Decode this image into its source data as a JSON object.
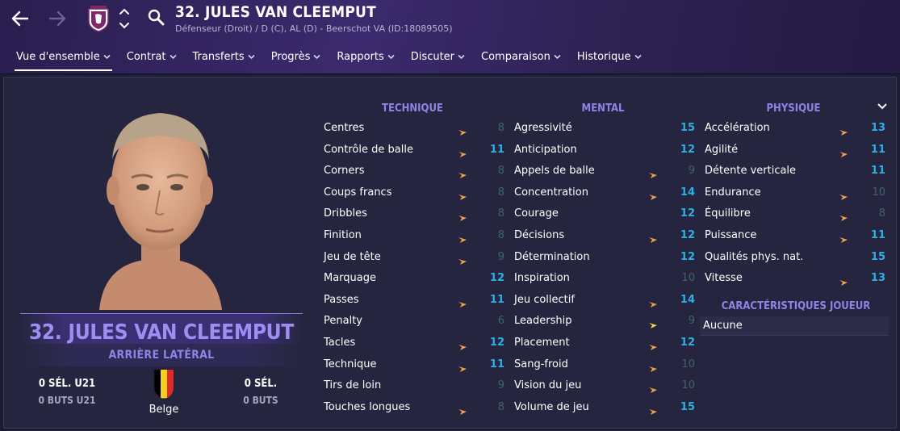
{
  "header": {
    "player_title": "32. JULES VAN CLEEMPUT",
    "player_subtitle": "Défenseur (Droit) / D (C), AL (D) - Beerschot VA (ID:18089505)",
    "icons": [
      "back-arrow-icon",
      "forward-arrow-icon",
      "club-badge-icon",
      "up-down-chevron-icon",
      "search-icon"
    ]
  },
  "tabs": [
    {
      "label": "Vue d'ensemble",
      "active": true
    },
    {
      "label": "Contrat",
      "active": false
    },
    {
      "label": "Transferts",
      "active": false
    },
    {
      "label": "Progrès",
      "active": false
    },
    {
      "label": "Rapports",
      "active": false
    },
    {
      "label": "Discuter",
      "active": false
    },
    {
      "label": "Comparaison",
      "active": false
    },
    {
      "label": "Historique",
      "active": false
    }
  ],
  "profile": {
    "name_banner": "32. JULES VAN CLEEMPUT",
    "role": "ARRIÈRE LATÉRAL",
    "u21_caps": "0 SÉL. U21",
    "u21_goals": "0 BUTS U21",
    "caps": "0 SÉL.",
    "goals": "0 BUTS",
    "nationality": "Belge"
  },
  "technique": {
    "title": "TECHNIQUE",
    "rows": [
      {
        "name": "Centres",
        "value": "8",
        "arrow": "orange"
      },
      {
        "name": "Contrôle de balle",
        "value": "11",
        "arrow": "orange"
      },
      {
        "name": "Corners",
        "value": "8",
        "arrow": "orange"
      },
      {
        "name": "Coups francs",
        "value": "8",
        "arrow": "orange"
      },
      {
        "name": "Dribbles",
        "value": "8",
        "arrow": "orange"
      },
      {
        "name": "Finition",
        "value": "8",
        "arrow": "orange"
      },
      {
        "name": "Jeu de tête",
        "value": "9",
        "arrow": "orange"
      },
      {
        "name": "Marquage",
        "value": "12",
        "arrow": "none"
      },
      {
        "name": "Passes",
        "value": "11",
        "arrow": "orange"
      },
      {
        "name": "Penalty",
        "value": "6",
        "arrow": "none"
      },
      {
        "name": "Tacles",
        "value": "12",
        "arrow": "orange"
      },
      {
        "name": "Technique",
        "value": "11",
        "arrow": "orange"
      },
      {
        "name": "Tirs de loin",
        "value": "9",
        "arrow": "none"
      },
      {
        "name": "Touches longues",
        "value": "8",
        "arrow": "orange"
      }
    ]
  },
  "mental": {
    "title": "MENTAL",
    "rows": [
      {
        "name": "Agressivité",
        "value": "15",
        "arrow": "none"
      },
      {
        "name": "Anticipation",
        "value": "12",
        "arrow": "none"
      },
      {
        "name": "Appels de balle",
        "value": "9",
        "arrow": "orange"
      },
      {
        "name": "Concentration",
        "value": "14",
        "arrow": "orange"
      },
      {
        "name": "Courage",
        "value": "12",
        "arrow": "none"
      },
      {
        "name": "Décisions",
        "value": "12",
        "arrow": "orange"
      },
      {
        "name": "Détermination",
        "value": "12",
        "arrow": "none"
      },
      {
        "name": "Inspiration",
        "value": "10",
        "arrow": "none"
      },
      {
        "name": "Jeu collectif",
        "value": "14",
        "arrow": "orange"
      },
      {
        "name": "Leadership",
        "value": "9",
        "arrow": "yellow"
      },
      {
        "name": "Placement",
        "value": "12",
        "arrow": "orange"
      },
      {
        "name": "Sang-froid",
        "value": "10",
        "arrow": "orange"
      },
      {
        "name": "Vision du jeu",
        "value": "10",
        "arrow": "orange"
      },
      {
        "name": "Volume de jeu",
        "value": "15",
        "arrow": "orange"
      }
    ]
  },
  "physique": {
    "title": "PHYSIQUE",
    "rows": [
      {
        "name": "Accélération",
        "value": "13",
        "arrow": "orange"
      },
      {
        "name": "Agilité",
        "value": "11",
        "arrow": "orange"
      },
      {
        "name": "Détente verticale",
        "value": "11",
        "arrow": "none"
      },
      {
        "name": "Endurance",
        "value": "10",
        "arrow": "orange"
      },
      {
        "name": "Équilibre",
        "value": "8",
        "arrow": "orange"
      },
      {
        "name": "Puissance",
        "value": "11",
        "arrow": "orange"
      },
      {
        "name": "Qualités phys. nat.",
        "value": "15",
        "arrow": "none"
      },
      {
        "name": "Vitesse",
        "value": "13",
        "arrow": "orange"
      }
    ]
  },
  "characteristics": {
    "title": "CARACTÉRISTIQUES JOUEUR",
    "value": "Aucune"
  },
  "colors": {
    "accent": "#8f83e8",
    "value_high": "#2bb1e6",
    "value_low": "#3f6470",
    "arrow_orange": "#f0a050",
    "arrow_yellow": "#e8e040"
  }
}
